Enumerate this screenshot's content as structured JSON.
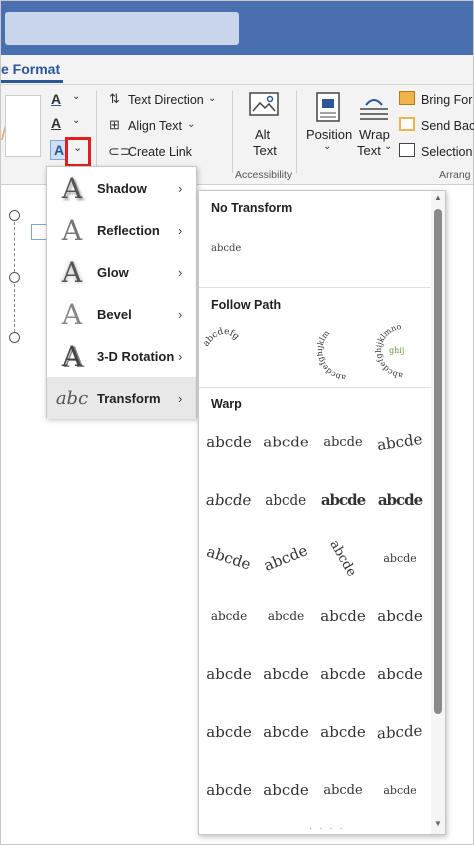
{
  "ribbon": {
    "tab_active": "e Format",
    "text_direction": "Text Direction",
    "align_text": "Align Text",
    "create_link": "Create Link",
    "alt_text_line1": "Alt",
    "alt_text_line2": "Text",
    "accessibility_label": "Accessibility",
    "position_label": "Position",
    "wrap_text_line1": "Wrap",
    "wrap_text_line2": "Text",
    "bring_forward": "Bring For",
    "send_backward": "Send Bac",
    "selection_pane": "Selection",
    "arrange_label": "Arrang",
    "chevron": "⌄"
  },
  "effects_menu": {
    "items": [
      {
        "label": "Shadow",
        "icon": "text-shadow-icon"
      },
      {
        "label": "Reflection",
        "icon": "text-reflection-icon"
      },
      {
        "label": "Glow",
        "icon": "text-glow-icon"
      },
      {
        "label": "Bevel",
        "icon": "text-bevel-icon"
      },
      {
        "label": "3-D Rotation",
        "icon": "text-3d-rotation-icon"
      },
      {
        "label": "Transform",
        "icon": "text-transform-icon"
      }
    ],
    "glyph": "A",
    "transform_glyph": "abc"
  },
  "transform_gallery": {
    "no_transform_title": "No Transform",
    "no_transform_sample": "abcde",
    "follow_path_title": "Follow Path",
    "follow_path_samples": [
      "abcdefg",
      "abcdefghijklm",
      "abcdefghijklmno"
    ],
    "warp_title": "Warp",
    "warp_samples": [
      "abcde",
      "abcde",
      "abcde",
      "abcde",
      "abcde",
      "abcde",
      "abcde",
      "abcde",
      "abcde",
      "abcde",
      "abcde",
      "abcde",
      "abcde",
      "abcde",
      "abcde",
      "abcde",
      "abcde",
      "abcde",
      "abcde",
      "abcde",
      "abcde",
      "abcde",
      "abcde",
      "abcde",
      "abcde",
      "abcde",
      "abcde",
      "abcde"
    ]
  },
  "colors": {
    "title_bar": "#4a6fb0",
    "accent": "#2b579a",
    "highlight_box": "#e01f1f"
  }
}
